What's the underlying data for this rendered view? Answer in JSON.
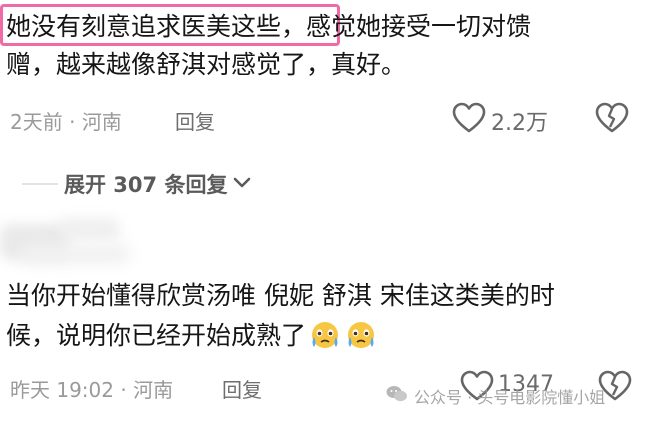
{
  "comments": [
    {
      "highlight_text": "她没有刻意追求医美这些，",
      "rest_text_line1": "感觉她接受一切对馈",
      "text_line2": "赠，越来越像舒淇对感觉了，真好。",
      "time": "2天前",
      "location": "河南",
      "separator": "·",
      "reply_label": "回复",
      "like_count": "2.2万",
      "expand_label": "展开 307 条回复"
    },
    {
      "text_line1": "当你开始懂得欣赏汤唯 倪妮 舒淇 宋佳这类美的时",
      "text_line2": "候，说明你已经开始成熟了",
      "time": "昨天 19:02",
      "location": "河南",
      "separator": "·",
      "reply_label": "回复",
      "like_count": "1347"
    }
  ],
  "watermark": {
    "text": "公众号 · 头号电影院懂小姐"
  },
  "colors": {
    "highlight_border": "#f06aa6",
    "meta_text": "#9a9a9a",
    "emoji_face": "#f7c744",
    "emoji_tear": "#5aa9f0"
  },
  "icons": [
    "heart-outline-icon",
    "broken-heart-icon",
    "chevron-down-icon",
    "crying-emoji-icon",
    "wechat-icon"
  ]
}
